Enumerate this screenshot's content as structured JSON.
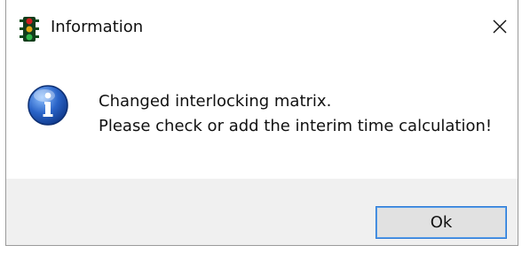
{
  "dialog": {
    "title": "Information",
    "title_icon": "traffic-light-icon",
    "close_icon": "close-icon",
    "message_icon": "info-icon",
    "message_lines": [
      "Changed interlocking matrix.",
      "Please check or add the interim time calculation!"
    ],
    "ok_label": "Ok"
  },
  "colors": {
    "info_icon_blue": "#2a64c8",
    "button_focus_border": "#2e7bd6",
    "footer_background": "#f0f0f0"
  }
}
